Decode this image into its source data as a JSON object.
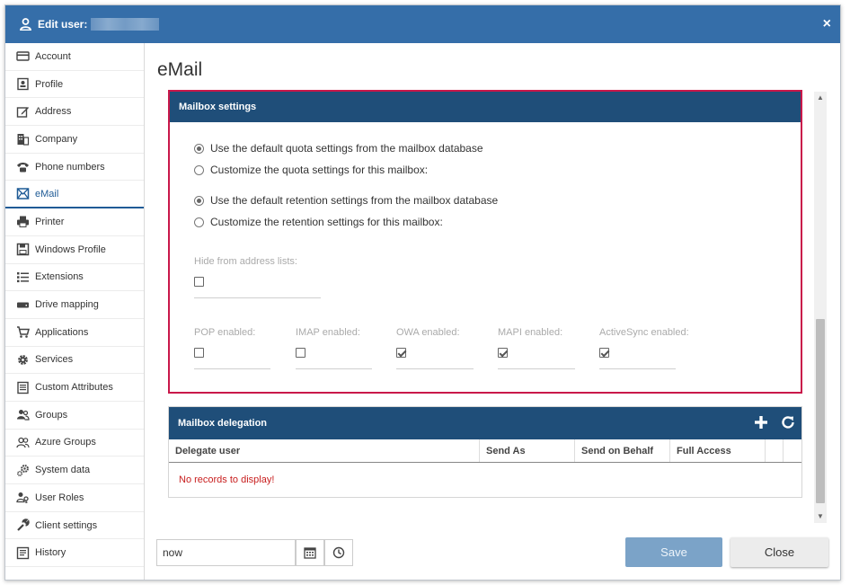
{
  "window": {
    "title": "Edit user:",
    "close_glyph": "×"
  },
  "sidebar": {
    "items": [
      {
        "label": "Account",
        "icon": "card-icon"
      },
      {
        "label": "Profile",
        "icon": "profile-icon"
      },
      {
        "label": "Address",
        "icon": "edit-icon"
      },
      {
        "label": "Company",
        "icon": "building-icon"
      },
      {
        "label": "Phone numbers",
        "icon": "phone-icon"
      },
      {
        "label": "eMail",
        "icon": "mail-icon",
        "active": true
      },
      {
        "label": "Printer",
        "icon": "printer-icon"
      },
      {
        "label": "Windows Profile",
        "icon": "floppy-icon"
      },
      {
        "label": "Extensions",
        "icon": "list-icon"
      },
      {
        "label": "Drive mapping",
        "icon": "drive-icon"
      },
      {
        "label": "Applications",
        "icon": "cart-icon"
      },
      {
        "label": "Services",
        "icon": "gear-icon"
      },
      {
        "label": "Custom Attributes",
        "icon": "book-icon"
      },
      {
        "label": "Groups",
        "icon": "group-icon"
      },
      {
        "label": "Azure Groups",
        "icon": "users-icon"
      },
      {
        "label": "System data",
        "icon": "gears-icon"
      },
      {
        "label": "User Roles",
        "icon": "user-key-icon"
      },
      {
        "label": "Client settings",
        "icon": "wrench-icon"
      },
      {
        "label": "History",
        "icon": "history-icon"
      }
    ]
  },
  "main": {
    "title": "eMail",
    "mailbox_settings": {
      "header": "Mailbox settings",
      "quota_default": "Use the default quota settings from the mailbox database",
      "quota_custom": "Customize the quota settings for this mailbox:",
      "retention_default": "Use the default retention settings from the mailbox database",
      "retention_custom": "Customize the retention settings for this mailbox:",
      "hide_label": "Hide from address lists:",
      "hide_checked": false,
      "protocols": [
        {
          "label": "POP enabled:",
          "checked": false
        },
        {
          "label": "IMAP enabled:",
          "checked": false
        },
        {
          "label": "OWA enabled:",
          "checked": true
        },
        {
          "label": "MAPI enabled:",
          "checked": true
        },
        {
          "label": "ActiveSync enabled:",
          "checked": true
        }
      ]
    },
    "delegation": {
      "header": "Mailbox delegation",
      "columns": [
        "Delegate user",
        "Send As",
        "Send on Behalf",
        "Full Access"
      ],
      "empty_text": "No records to display!"
    }
  },
  "footer": {
    "date_value": "now",
    "save_label": "Save",
    "close_label": "Close"
  },
  "colors": {
    "titlebar": "#356ea9",
    "panel_header": "#1f4e79",
    "highlight_border": "#c9184a",
    "save_button": "#7ba3c8",
    "error_text": "#c81e1e"
  }
}
